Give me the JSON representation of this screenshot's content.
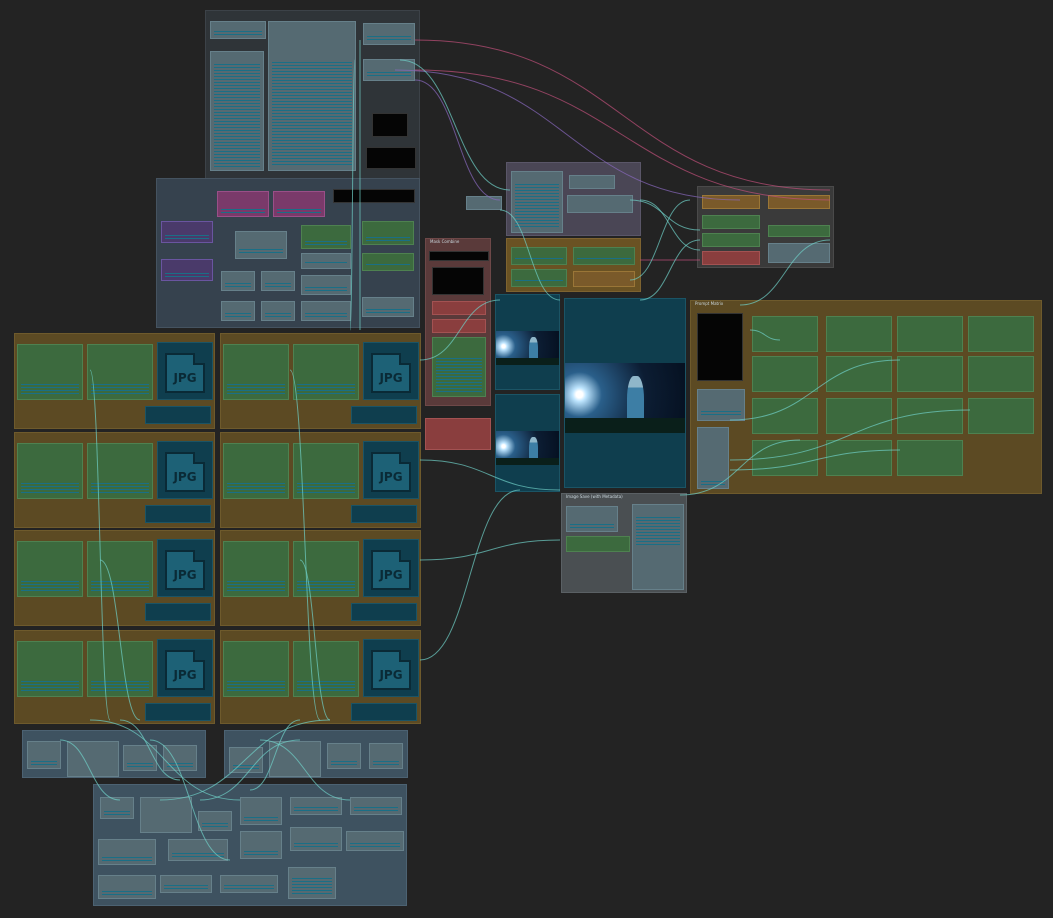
{
  "group_titles": {
    "main": "",
    "mask": "Mask Combine",
    "image_save": "Image Save (with Metadata)",
    "right": "Prompt Matrix",
    "preview": "",
    "bottom_left": "",
    "bottom_right": ""
  },
  "jpg_label": "JPG",
  "colors": {
    "background": "#232323",
    "wire_cyan": "#6fd0c8",
    "wire_purple": "#8a6ac0",
    "wire_pink": "#c0507a"
  },
  "image_preview": {
    "description_icon": "photo-icon"
  }
}
